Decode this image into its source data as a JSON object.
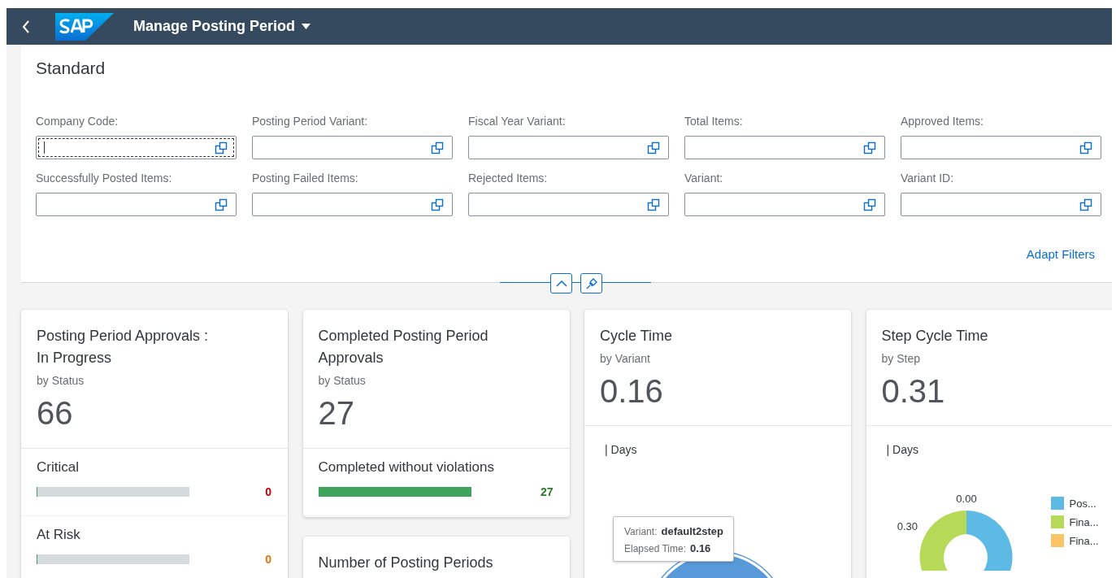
{
  "shell": {
    "title": "Manage Posting Period"
  },
  "filter_bar": {
    "variant": "Standard",
    "adapt_filters": "Adapt Filters",
    "filters": [
      {
        "label": "Company Code:",
        "focused": true
      },
      {
        "label": "Posting Period Variant:",
        "focused": false
      },
      {
        "label": "Fiscal Year Variant:",
        "focused": false
      },
      {
        "label": "Total Items:",
        "focused": false
      },
      {
        "label": "Approved Items:",
        "focused": false
      },
      {
        "label": "Successfully Posted Items:",
        "focused": false
      },
      {
        "label": "Posting Failed Items:",
        "focused": false
      },
      {
        "label": "Rejected Items:",
        "focused": false
      },
      {
        "label": "Variant:",
        "focused": false
      },
      {
        "label": "Variant ID:",
        "focused": false
      }
    ]
  },
  "cards": [
    {
      "kind": "status",
      "title": "Posting Period Approvals : In Progress",
      "subtitle": "by Status",
      "value": "66",
      "items": [
        {
          "label": "Critical",
          "level": 0,
          "value": "0",
          "color": "#bb0000"
        },
        {
          "label": "At Risk",
          "level": 0,
          "value": "0",
          "color": "#e9730c"
        }
      ]
    },
    {
      "kind": "status",
      "title": "Completed Posting Period Approvals",
      "subtitle": "by Status",
      "value": "27",
      "items": [
        {
          "label": "Completed without violations",
          "level": 1,
          "value": "27",
          "color": "#2b7d2b"
        }
      ]
    },
    {
      "kind": "status",
      "title": "Number of Posting Periods"
    },
    {
      "kind": "cycle",
      "title": "Cycle Time",
      "subtitle": "by Variant",
      "value": "0.16",
      "axis_label": "| Days",
      "tooltip": [
        {
          "label": "Variant:",
          "value": "default2step"
        },
        {
          "label": "Elapsed Time:",
          "value": "0.16"
        }
      ]
    },
    {
      "kind": "step",
      "title": "Step Cycle Time",
      "subtitle": "by Step",
      "value": "0.31",
      "axis_label": "| Days",
      "data_labels": [
        "0.00",
        "0.30"
      ],
      "legend": [
        {
          "label": "Pos...",
          "color": "#5cbae5"
        },
        {
          "label": "Fina...",
          "color": "#b6d957"
        },
        {
          "label": "Fina...",
          "color": "#fac364"
        }
      ]
    }
  ]
}
